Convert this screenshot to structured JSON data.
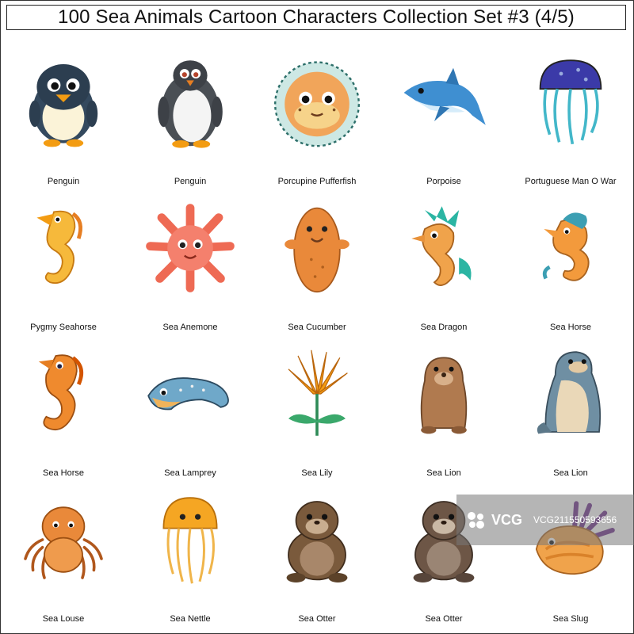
{
  "title": "100 Sea Animals Cartoon Characters Collection Set #3 (4/5)",
  "items": [
    {
      "label": "Penguin",
      "icon": "penguin-icon"
    },
    {
      "label": "Penguin",
      "icon": "penguin-icon"
    },
    {
      "label": "Porcupine Pufferfish",
      "icon": "pufferfish-icon"
    },
    {
      "label": "Porpoise",
      "icon": "porpoise-icon"
    },
    {
      "label": "Portuguese Man O War",
      "icon": "jellyfish-icon"
    },
    {
      "label": "Pygmy Seahorse",
      "icon": "seahorse-icon"
    },
    {
      "label": "Sea Anemone",
      "icon": "anemone-icon"
    },
    {
      "label": "Sea Cucumber",
      "icon": "sea-cucumber-icon"
    },
    {
      "label": "Sea Dragon",
      "icon": "sea-dragon-icon"
    },
    {
      "label": "Sea Horse",
      "icon": "seahorse-icon"
    },
    {
      "label": "Sea Horse",
      "icon": "seahorse-icon"
    },
    {
      "label": "Sea Lamprey",
      "icon": "lamprey-icon"
    },
    {
      "label": "Sea Lily",
      "icon": "sea-lily-icon"
    },
    {
      "label": "Sea Lion",
      "icon": "sea-lion-icon"
    },
    {
      "label": "Sea Lion",
      "icon": "sea-lion-icon"
    },
    {
      "label": "Sea Louse",
      "icon": "sea-louse-icon"
    },
    {
      "label": "Sea Nettle",
      "icon": "jellyfish-icon"
    },
    {
      "label": "Sea Otter",
      "icon": "otter-icon"
    },
    {
      "label": "Sea Otter",
      "icon": "otter-icon"
    },
    {
      "label": "Sea Slug",
      "icon": "sea-slug-icon"
    }
  ],
  "watermark": {
    "brand": "VCG",
    "id": "VCG211550593656"
  }
}
